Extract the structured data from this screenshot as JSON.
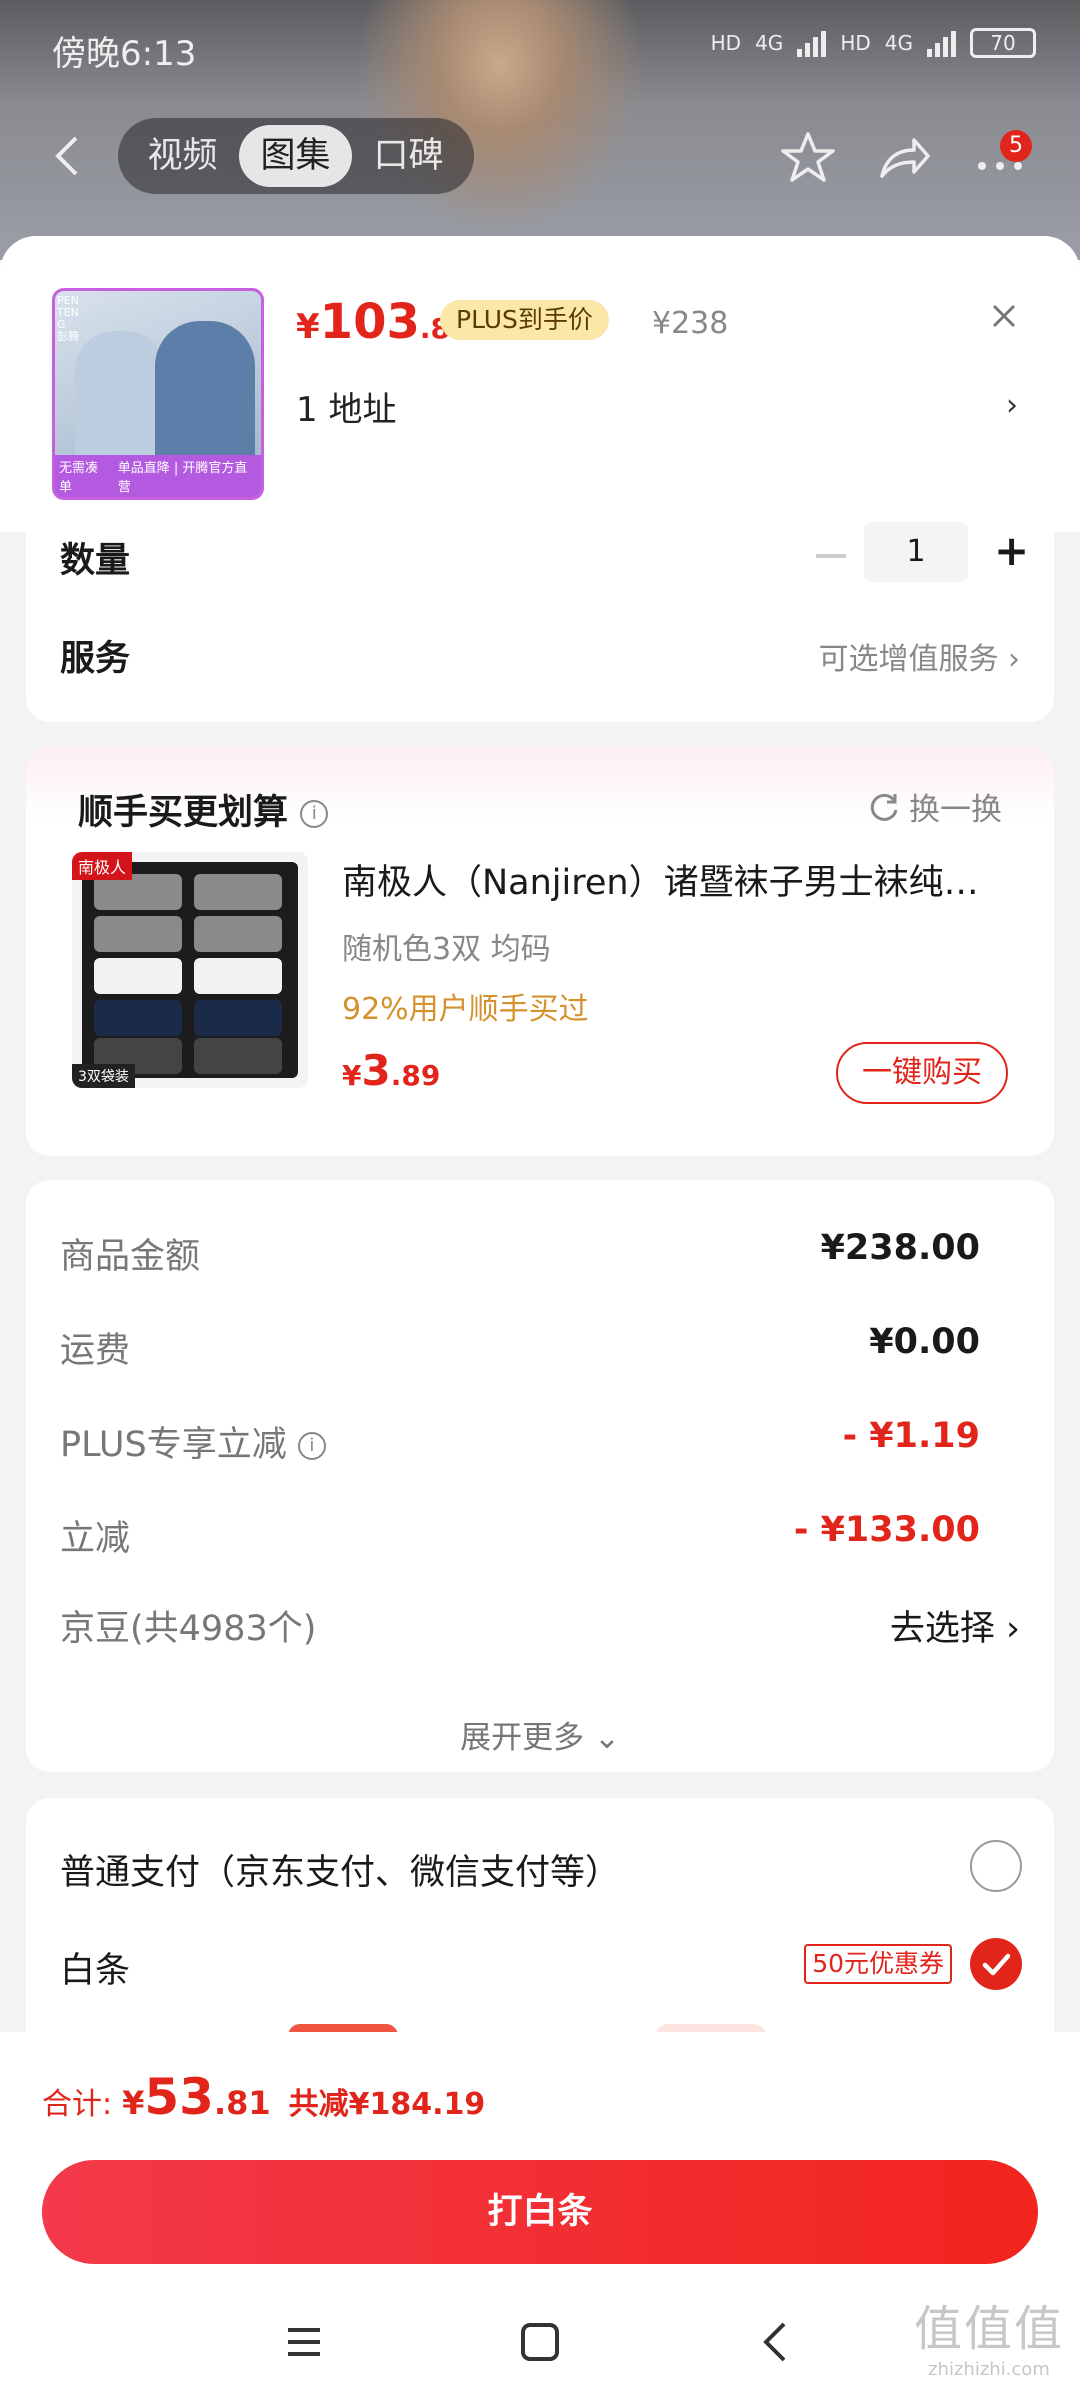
{
  "status_bar": {
    "time": "傍晚6:13",
    "battery": "70",
    "net1": "4G",
    "net2": "4G"
  },
  "nav": {
    "tabs": [
      "视频",
      "图集",
      "口碑"
    ],
    "active_tab": 1,
    "badge": "5"
  },
  "product": {
    "brand_vertical": "PENTENG 彭腾",
    "thumb_strip_left": "无需凑单",
    "thumb_strip_right": "单品直降 | 开腾官方直营",
    "price_currency": "¥",
    "price_int": "103",
    "price_dec": ".81",
    "plus_tag": "PLUS到手价",
    "original_price": "¥238",
    "address": "1  地址"
  },
  "options": {
    "quantity_label": "数量",
    "quantity_value": "1",
    "service_label": "服务",
    "service_value": "可选增值服务"
  },
  "addon": {
    "title": "顺手买更划算",
    "swap_label": "换一换",
    "img_brand": "南极人",
    "img_pack": "3双袋装",
    "name": "南极人（Nanjiren）诸暨袜子男士袜纯…",
    "spec": "随机色3双    均码",
    "percent": "92%用户顺手买过",
    "price_currency": "¥",
    "price_int": "3",
    "price_dec": ".89",
    "buy_label": "一键购买"
  },
  "summary": {
    "rows": [
      {
        "label": "商品金额",
        "value": "¥238.00"
      },
      {
        "label": "运费",
        "value": "¥0.00"
      },
      {
        "label": "PLUS专享立减",
        "value": "- ¥1.19"
      },
      {
        "label": "立减",
        "value": "- ¥133.00"
      },
      {
        "label": "京豆(共4983个)",
        "value": "去选择"
      }
    ],
    "expand_label": "展开更多"
  },
  "payment": {
    "normal_label": "普通支付（京东支付、微信支付等）",
    "baitiao_label": "白条",
    "coupon": "50元优惠券"
  },
  "footer": {
    "total_label": "合计:",
    "currency": "¥",
    "total_int": "53",
    "total_dec": ".81",
    "saved": "共减¥184.19",
    "cta": "打白条"
  },
  "watermark": {
    "big": "值值值",
    "small": "zhizhizhi.com"
  },
  "colors": {
    "accent": "#e1251b",
    "plus_bg": "#fbe8a6",
    "orange": "#d4912c"
  }
}
